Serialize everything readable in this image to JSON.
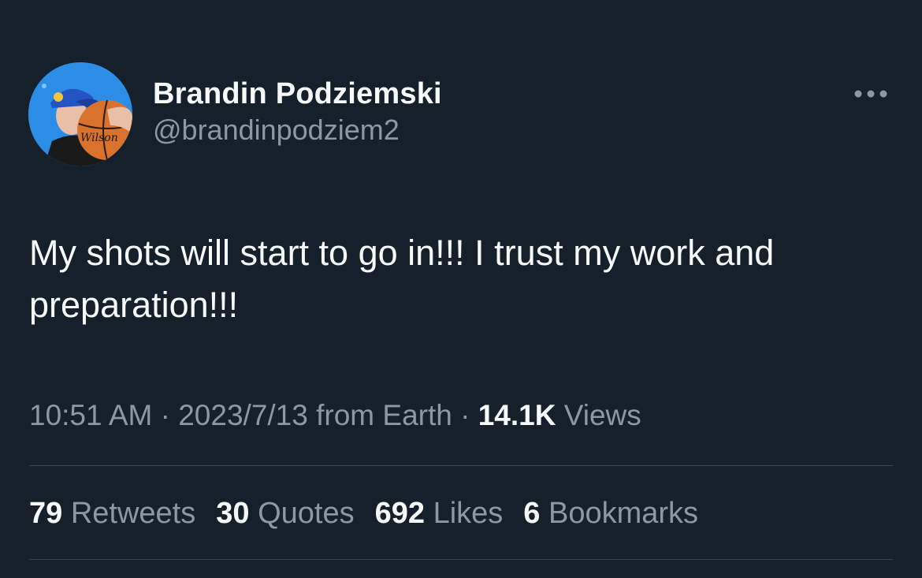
{
  "author": {
    "display_name": "Brandin Podziemski",
    "handle": "@brandinpodziem2",
    "avatar_icon": "avatar-photo"
  },
  "more_icon": "more-horizontal-icon",
  "tweet": {
    "text": "My shots will start to go in!!! I trust my work and\npreparation!!!"
  },
  "meta": {
    "time": "10:51 AM",
    "sep1": " · ",
    "date": "2023/7/13",
    "source": " from Earth",
    "sep2": " · ",
    "views_count": "14.1K",
    "views_label": " Views"
  },
  "stats": [
    {
      "count": "79",
      "label": " Retweets"
    },
    {
      "count": "30",
      "label": " Quotes"
    },
    {
      "count": "692",
      "label": " Likes"
    },
    {
      "count": "6",
      "label": " Bookmarks"
    }
  ],
  "colors": {
    "background": "#15202B",
    "primary_text": "#F7F9F9",
    "secondary_text": "#8B98A5",
    "divider": "#38444D"
  }
}
